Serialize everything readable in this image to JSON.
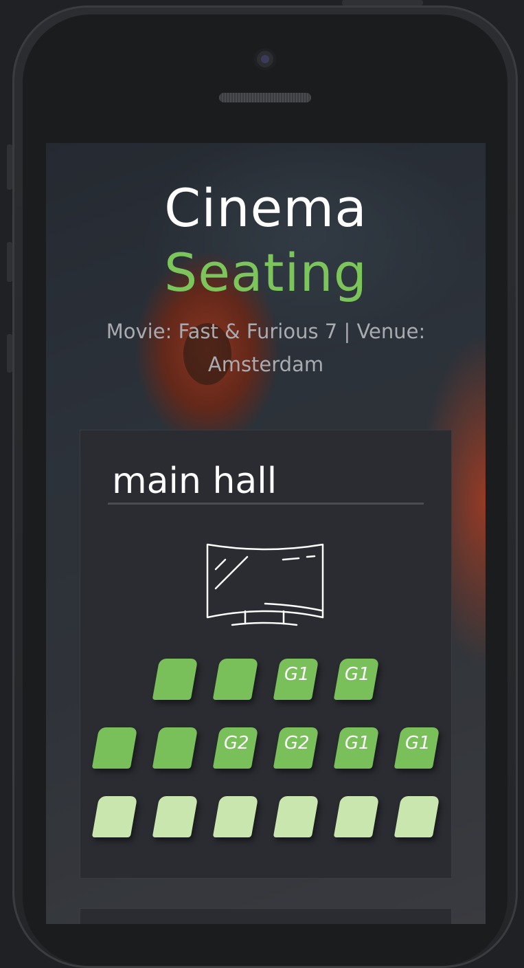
{
  "header": {
    "title_line1": "Cinema",
    "title_line2": "Seating",
    "subtitle": "Movie: Fast & Furious 7 | Venue: Amsterdam"
  },
  "hall": {
    "name": "main hall",
    "screen_icon": "curved-screen-icon"
  },
  "colors": {
    "accent_green": "#7cc55a",
    "seat_taken": "#7ac05a",
    "seat_free": "#c8e6ad"
  },
  "seat_rows": [
    {
      "seats": [
        {
          "label": "",
          "status": "taken"
        },
        {
          "label": "",
          "status": "taken"
        },
        {
          "label": "G1",
          "status": "taken"
        },
        {
          "label": "G1",
          "status": "taken"
        }
      ]
    },
    {
      "seats": [
        {
          "label": "",
          "status": "taken"
        },
        {
          "label": "",
          "status": "taken"
        },
        {
          "label": "G2",
          "status": "taken"
        },
        {
          "label": "G2",
          "status": "taken"
        },
        {
          "label": "G1",
          "status": "taken"
        },
        {
          "label": "G1",
          "status": "taken"
        }
      ]
    },
    {
      "seats": [
        {
          "label": "",
          "status": "free"
        },
        {
          "label": "",
          "status": "free"
        },
        {
          "label": "",
          "status": "free"
        },
        {
          "label": "",
          "status": "free"
        },
        {
          "label": "",
          "status": "free"
        },
        {
          "label": "",
          "status": "free"
        }
      ]
    }
  ]
}
